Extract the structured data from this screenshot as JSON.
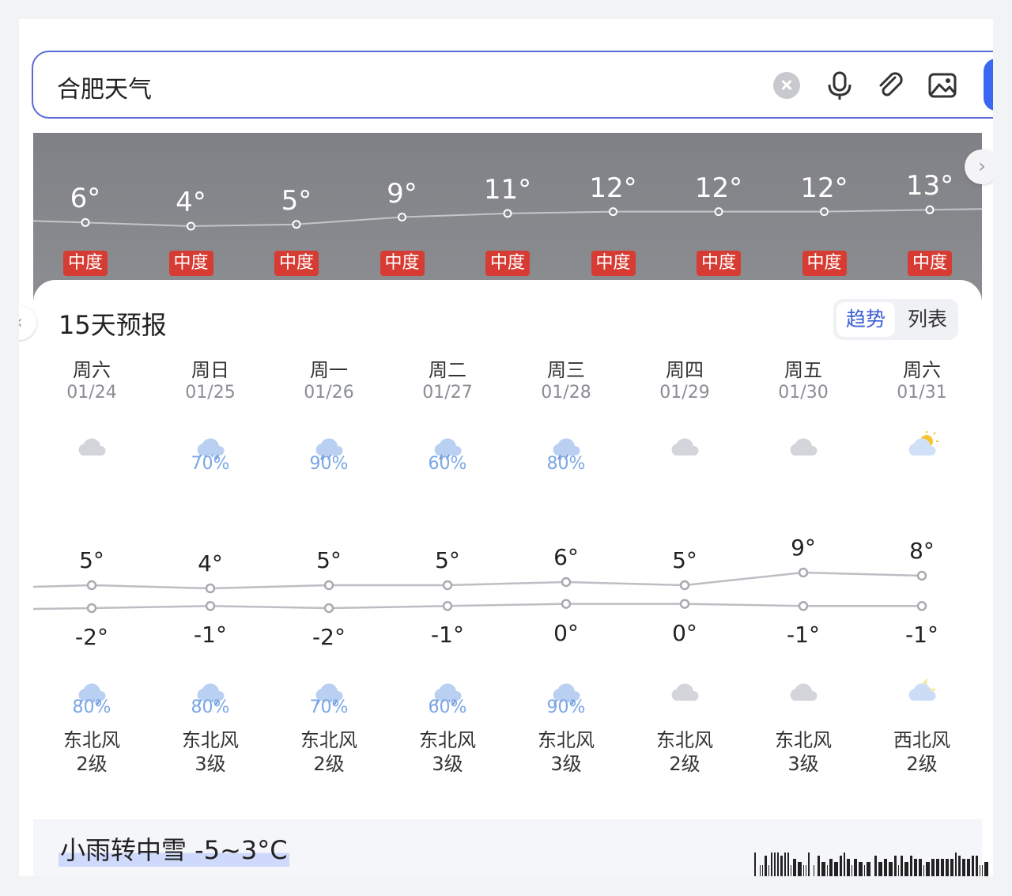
{
  "search": {
    "query": "合肥天气"
  },
  "hourly": {
    "temps": [
      "6°",
      "4°",
      "5°",
      "9°",
      "11°",
      "12°",
      "12°",
      "12°",
      "13°"
    ],
    "temp_values": [
      6,
      4,
      5,
      9,
      11,
      12,
      12,
      12,
      13
    ],
    "aqi": [
      "中度",
      "中度",
      "中度",
      "中度",
      "中度",
      "中度",
      "中度",
      "中度",
      "中度"
    ],
    "aqi_color": "#d63c33"
  },
  "forecast": {
    "title": "15天预报",
    "toggle": {
      "trend": "趋势",
      "list": "列表"
    },
    "days": [
      {
        "weekday": "周六",
        "date": "01/24",
        "day_icon": "cloudy-icon",
        "day_pop": "",
        "high": "5°",
        "high_value": 5,
        "low": "-2°",
        "low_value": -2,
        "night_icon": "snow-icon",
        "night_pop": "80%",
        "wind_dir": "东北风",
        "wind_level": "2级"
      },
      {
        "weekday": "周日",
        "date": "01/25",
        "day_icon": "snow-icon",
        "day_pop": "70%",
        "high": "4°",
        "high_value": 4,
        "low": "-1°",
        "low_value": -1,
        "night_icon": "snow-icon",
        "night_pop": "80%",
        "wind_dir": "东北风",
        "wind_level": "3级"
      },
      {
        "weekday": "周一",
        "date": "01/26",
        "day_icon": "rain-icon",
        "day_pop": "90%",
        "high": "5°",
        "high_value": 5,
        "low": "-2°",
        "low_value": -2,
        "night_icon": "snow-icon",
        "night_pop": "70%",
        "wind_dir": "东北风",
        "wind_level": "2级"
      },
      {
        "weekday": "周二",
        "date": "01/27",
        "day_icon": "rain-icon",
        "day_pop": "60%",
        "high": "5°",
        "high_value": 5,
        "low": "-1°",
        "low_value": -1,
        "night_icon": "snow-icon",
        "night_pop": "60%",
        "wind_dir": "东北风",
        "wind_level": "3级"
      },
      {
        "weekday": "周三",
        "date": "01/28",
        "day_icon": "rain-icon",
        "day_pop": "80%",
        "high": "6°",
        "high_value": 6,
        "low": "0°",
        "low_value": 0,
        "night_icon": "snow-icon",
        "night_pop": "90%",
        "wind_dir": "东北风",
        "wind_level": "3级"
      },
      {
        "weekday": "周四",
        "date": "01/29",
        "day_icon": "cloudy-icon",
        "day_pop": "",
        "high": "5°",
        "high_value": 5,
        "low": "0°",
        "low_value": 0,
        "night_icon": "cloudy-icon",
        "night_pop": "",
        "wind_dir": "东北风",
        "wind_level": "2级"
      },
      {
        "weekday": "周五",
        "date": "01/30",
        "day_icon": "cloudy-icon",
        "day_pop": "",
        "high": "9°",
        "high_value": 9,
        "low": "-1°",
        "low_value": -1,
        "night_icon": "cloudy-icon",
        "night_pop": "",
        "wind_dir": "东北风",
        "wind_level": "3级"
      },
      {
        "weekday": "周六",
        "date": "01/31",
        "day_icon": "partly-sunny-icon",
        "day_pop": "",
        "high": "8°",
        "high_value": 8,
        "low": "-1°",
        "low_value": -1,
        "night_icon": "cloudy-night-icon",
        "night_pop": "",
        "wind_dir": "西北风",
        "wind_level": "2级"
      }
    ]
  },
  "summary": {
    "text": "小雨转中雪 -5~3°C"
  },
  "colors": {
    "accent": "#3b5fd6",
    "precip": "#7aa7e6",
    "search_border": "#5b6bd6"
  }
}
